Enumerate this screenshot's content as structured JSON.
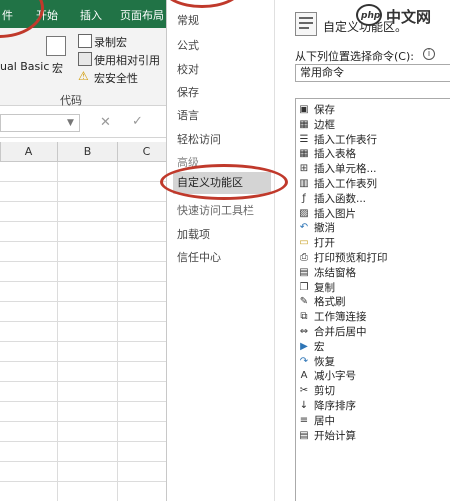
{
  "excel": {
    "tabs": [
      "件",
      "开始",
      "插入",
      "页面布局"
    ],
    "ribbon": {
      "visual_basic": "ual Basic",
      "macro": "宏",
      "record_macro": "录制宏",
      "use_relative": "使用相对引用",
      "macro_security": "宏安全性",
      "group_label": "代码"
    },
    "columns": [
      "A",
      "B",
      "C"
    ]
  },
  "dialog": {
    "nav": [
      "常规",
      "公式",
      "校对",
      "保存",
      "语言",
      "轻松访问",
      "高级",
      "自定义功能区",
      "快速访问工具栏",
      "加载项",
      "信任中心"
    ],
    "selected_nav": "自定义功能区",
    "header_title": "自定义功能区。",
    "choose_commands_label": "从下列位置选择命令(C):",
    "choose_commands_value": "常用命令",
    "commands": [
      {
        "label": "保存",
        "icon": "save-icon"
      },
      {
        "label": "边框",
        "icon": "border-icon"
      },
      {
        "label": "插入工作表行",
        "icon": "insert-row-icon"
      },
      {
        "label": "插入表格",
        "icon": "insert-table-icon"
      },
      {
        "label": "插入单元格...",
        "icon": "insert-cells-icon"
      },
      {
        "label": "插入工作表列",
        "icon": "insert-column-icon"
      },
      {
        "label": "插入函数...",
        "icon": "function-icon"
      },
      {
        "label": "插入图片",
        "icon": "picture-icon"
      },
      {
        "label": "撤消",
        "icon": "undo-icon"
      },
      {
        "label": "打开",
        "icon": "open-folder-icon"
      },
      {
        "label": "打印预览和打印",
        "icon": "print-preview-icon"
      },
      {
        "label": "冻结窗格",
        "icon": "freeze-panes-icon"
      },
      {
        "label": "复制",
        "icon": "copy-icon"
      },
      {
        "label": "格式刷",
        "icon": "format-painter-icon"
      },
      {
        "label": "工作簿连接",
        "icon": "workbook-connections-icon"
      },
      {
        "label": "合并后居中",
        "icon": "merge-center-icon"
      },
      {
        "label": "宏",
        "icon": "macro-icon"
      },
      {
        "label": "恢复",
        "icon": "redo-icon"
      },
      {
        "label": "减小字号",
        "icon": "decrease-font-icon"
      },
      {
        "label": "剪切",
        "icon": "cut-icon"
      },
      {
        "label": "降序排序",
        "icon": "sort-descending-icon"
      },
      {
        "label": "居中",
        "icon": "center-icon"
      },
      {
        "label": "开始计算",
        "icon": "calculate-icon"
      }
    ]
  },
  "watermark": {
    "logo": "php",
    "text": "中文网"
  },
  "colors": {
    "excel_green": "#217346",
    "annotation_red": "#c0392b",
    "selected_nav": "#d4d4d4"
  }
}
